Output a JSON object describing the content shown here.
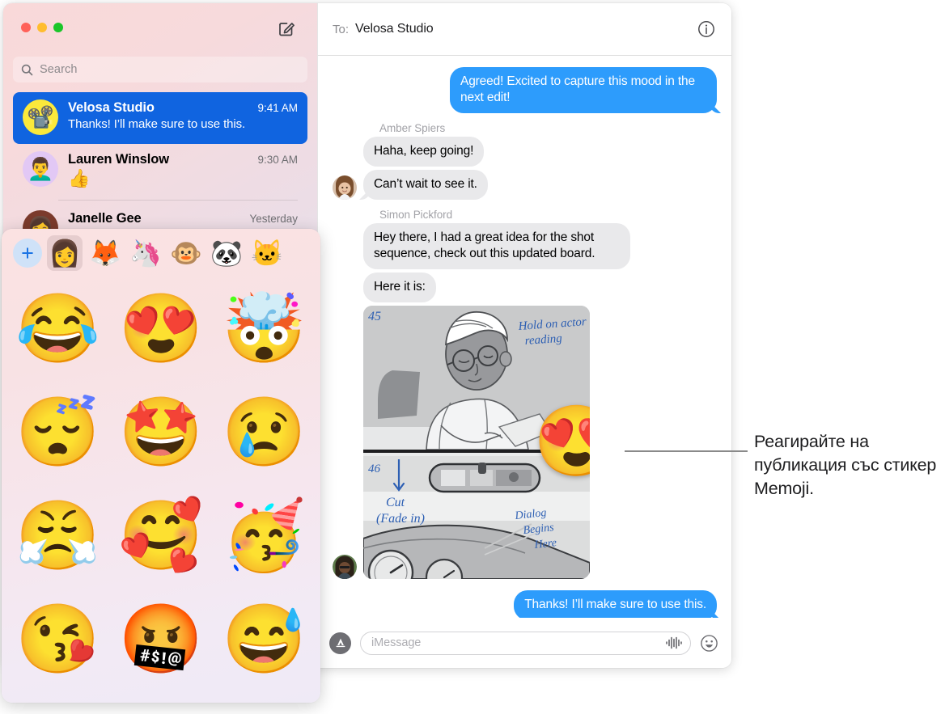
{
  "window": {
    "traffic_lights": [
      "close",
      "minimize",
      "zoom"
    ],
    "compose_icon": "compose-icon"
  },
  "sidebar": {
    "search": {
      "placeholder": "Search",
      "icon": "search-icon"
    },
    "conversations": [
      {
        "name": "Velosa Studio",
        "time": "9:41 AM",
        "preview": "Thanks! I’ll make sure to use this.",
        "avatar_emoji": "📽️",
        "avatar_style": "av-yellow",
        "selected": true
      },
      {
        "name": "Lauren Winslow",
        "time": "9:30 AM",
        "preview": "👍",
        "avatar_emoji": "👨‍🦱",
        "avatar_style": "av-purple",
        "selected": false
      },
      {
        "name": "Janelle Gee",
        "time": "Yesterday",
        "preview": "",
        "avatar_emoji": "👩",
        "avatar_style": "av-dark",
        "selected": false
      }
    ]
  },
  "chat": {
    "to_label": "To:",
    "recipient": "Velosa Studio",
    "info_icon": "info-icon",
    "messages": [
      {
        "direction": "out",
        "text": "Agreed! Excited to capture this mood in the next edit!",
        "sender": null
      },
      {
        "direction": "in",
        "sender": "Amber Spiers",
        "text": "Haha, keep going!"
      },
      {
        "direction": "in",
        "sender": null,
        "text": "Can’t wait to see it."
      },
      {
        "direction": "in",
        "sender": "Simon Pickford",
        "text": "Hey there, I had a great idea for the shot sequence, check out this updated board."
      },
      {
        "direction": "in",
        "sender": null,
        "text": "Here it is:"
      },
      {
        "direction": "out",
        "sender": null,
        "text": "Thanks! I’ll make sure to use this."
      }
    ],
    "attachment": {
      "type": "storyboard-image",
      "frame_labels": [
        "45",
        "46"
      ],
      "annotations": [
        "Hold on actor reading",
        "Cut (Fade in)",
        "Dialog Begins Here"
      ],
      "reaction_sticker": "😍"
    },
    "composer": {
      "apps_icon": "app-store-icon",
      "placeholder": "iMessage",
      "audio_icon": "audio-waveform-icon",
      "emoji_icon": "emoji-smiley-icon"
    }
  },
  "sticker_picker": {
    "add_icon": "plus-icon",
    "tabs": [
      {
        "icon": "👩",
        "label": "memoji-self",
        "active": true
      },
      {
        "icon": "🦊",
        "label": "fox",
        "active": false
      },
      {
        "icon": "🦄",
        "label": "unicorn",
        "active": false
      },
      {
        "icon": "🐵",
        "label": "monkey",
        "active": false
      },
      {
        "icon": "🐼",
        "label": "panda",
        "active": false
      },
      {
        "icon": "🐱",
        "label": "cat",
        "active": false
      }
    ],
    "stickers": [
      {
        "icon": "😂",
        "label": "memoji-tears-of-joy"
      },
      {
        "icon": "😍",
        "label": "memoji-heart-eyes"
      },
      {
        "icon": "🤯",
        "label": "memoji-mind-blown"
      },
      {
        "icon": "😴",
        "label": "memoji-sleeping"
      },
      {
        "icon": "🤩",
        "label": "memoji-star-struck"
      },
      {
        "icon": "😢",
        "label": "memoji-crying"
      },
      {
        "icon": "😤",
        "label": "memoji-steam-nose"
      },
      {
        "icon": "🥰",
        "label": "memoji-smiling-hearts"
      },
      {
        "icon": "🥳",
        "label": "memoji-party"
      },
      {
        "icon": "😘",
        "label": "memoji-kiss-heart"
      },
      {
        "icon": "🤬",
        "label": "memoji-cursing"
      },
      {
        "icon": "😅",
        "label": "memoji-sweat-smile"
      }
    ]
  },
  "callout": {
    "text": "Реагирайте на публикация със стикер Memoji."
  },
  "colors": {
    "accent_blue": "#2d9cfc",
    "selected_row": "#1064e0",
    "bubble_gray": "#e9e9eb"
  }
}
